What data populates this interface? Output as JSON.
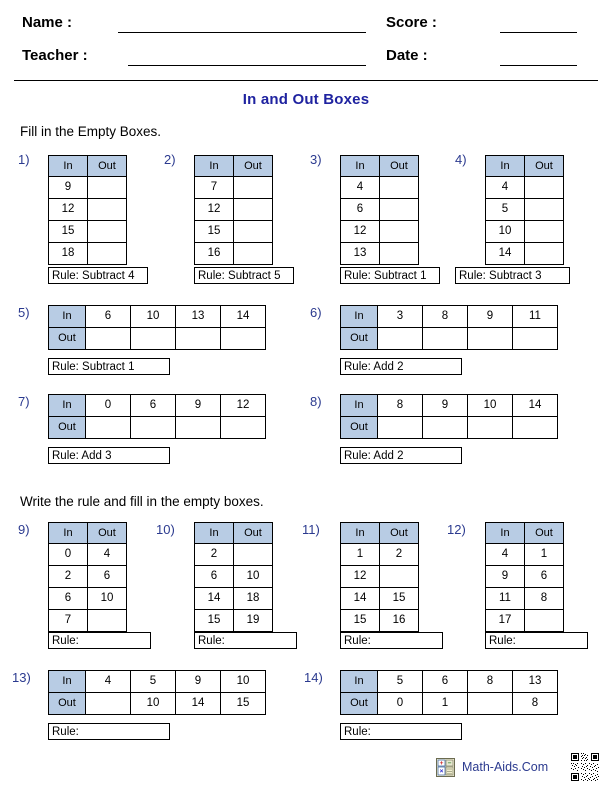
{
  "header": {
    "name_label": "Name :",
    "teacher_label": "Teacher :",
    "score_label": "Score :",
    "date_label": "Date :"
  },
  "title": "In and Out Boxes",
  "sections": [
    {
      "instruction": "Fill in the Empty Boxes."
    },
    {
      "instruction": "Write the rule and fill in the empty boxes."
    }
  ],
  "column_headers": {
    "in": "In",
    "out": "Out"
  },
  "rule_prefix": "Rule:",
  "problems": [
    {
      "number": "1)",
      "orientation": "vertical",
      "rows": [
        [
          "9",
          ""
        ],
        [
          "12",
          ""
        ],
        [
          "15",
          ""
        ],
        [
          "18",
          ""
        ]
      ],
      "rule": "Rule: Subtract 4"
    },
    {
      "number": "2)",
      "orientation": "vertical",
      "rows": [
        [
          "7",
          ""
        ],
        [
          "12",
          ""
        ],
        [
          "15",
          ""
        ],
        [
          "16",
          ""
        ]
      ],
      "rule": "Rule: Subtract 5"
    },
    {
      "number": "3)",
      "orientation": "vertical",
      "rows": [
        [
          "4",
          ""
        ],
        [
          "6",
          ""
        ],
        [
          "12",
          ""
        ],
        [
          "13",
          ""
        ]
      ],
      "rule": "Rule: Subtract 1"
    },
    {
      "number": "4)",
      "orientation": "vertical",
      "rows": [
        [
          "4",
          ""
        ],
        [
          "5",
          ""
        ],
        [
          "10",
          ""
        ],
        [
          "14",
          ""
        ]
      ],
      "rule": "Rule: Subtract 3"
    },
    {
      "number": "5)",
      "orientation": "horizontal",
      "in_values": [
        "6",
        "10",
        "13",
        "14"
      ],
      "out_values": [
        "",
        "",
        "",
        ""
      ],
      "rule": "Rule: Subtract 1"
    },
    {
      "number": "6)",
      "orientation": "horizontal",
      "in_values": [
        "3",
        "8",
        "9",
        "11"
      ],
      "out_values": [
        "",
        "",
        "",
        ""
      ],
      "rule": "Rule: Add 2"
    },
    {
      "number": "7)",
      "orientation": "horizontal",
      "in_values": [
        "0",
        "6",
        "9",
        "12"
      ],
      "out_values": [
        "",
        "",
        "",
        ""
      ],
      "rule": "Rule: Add 3"
    },
    {
      "number": "8)",
      "orientation": "horizontal",
      "in_values": [
        "8",
        "9",
        "10",
        "14"
      ],
      "out_values": [
        "",
        "",
        "",
        ""
      ],
      "rule": "Rule: Add 2"
    },
    {
      "number": "9)",
      "orientation": "vertical",
      "rows": [
        [
          "0",
          "4"
        ],
        [
          "2",
          "6"
        ],
        [
          "6",
          "10"
        ],
        [
          "7",
          ""
        ]
      ],
      "rule": "Rule:"
    },
    {
      "number": "10)",
      "orientation": "vertical",
      "rows": [
        [
          "2",
          ""
        ],
        [
          "6",
          "10"
        ],
        [
          "14",
          "18"
        ],
        [
          "15",
          "19"
        ]
      ],
      "rule": "Rule:"
    },
    {
      "number": "11)",
      "orientation": "vertical",
      "rows": [
        [
          "1",
          "2"
        ],
        [
          "12",
          ""
        ],
        [
          "14",
          "15"
        ],
        [
          "15",
          "16"
        ]
      ],
      "rule": "Rule:"
    },
    {
      "number": "12)",
      "orientation": "vertical",
      "rows": [
        [
          "4",
          "1"
        ],
        [
          "9",
          "6"
        ],
        [
          "11",
          "8"
        ],
        [
          "17",
          ""
        ]
      ],
      "rule": "Rule:"
    },
    {
      "number": "13)",
      "orientation": "horizontal",
      "in_values": [
        "4",
        "5",
        "9",
        "10"
      ],
      "out_values": [
        "",
        "10",
        "14",
        "15"
      ],
      "rule": "Rule:"
    },
    {
      "number": "14)",
      "orientation": "horizontal",
      "in_values": [
        "5",
        "6",
        "8",
        "13"
      ],
      "out_values": [
        "0",
        "1",
        "",
        "8"
      ],
      "rule": "Rule:"
    }
  ],
  "footer": {
    "site": "Math-Aids.Com",
    "logo_icon": "calculator-icon",
    "qr_icon": "qr-code-icon"
  },
  "colors": {
    "title": "#1f23a0",
    "header_fill": "#b8cce4",
    "problem_number": "#2b3a8f",
    "border": "#000000"
  }
}
